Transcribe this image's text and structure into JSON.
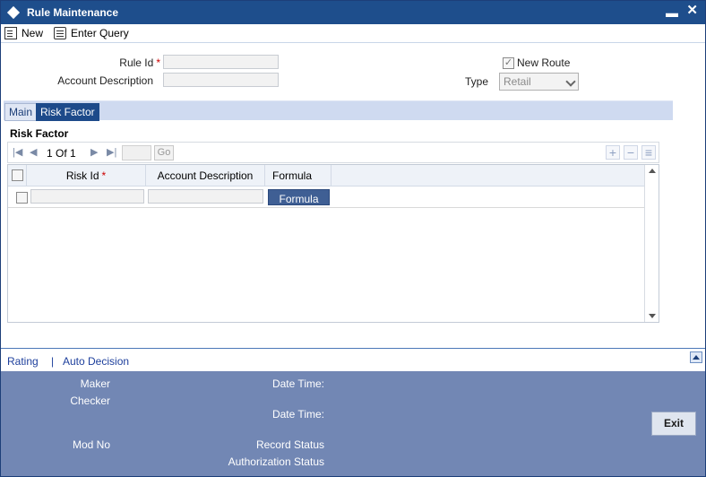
{
  "window": {
    "title": "Rule Maintenance",
    "min_glyph": "▬",
    "close_glyph": "✕"
  },
  "toolbar": {
    "new_label": "New",
    "enter_query_label": "Enter Query"
  },
  "form": {
    "rule_id_label": "Rule Id",
    "required_mark": "*",
    "account_description_label": "Account Description",
    "new_route_label": "New Route",
    "new_route_checked": true,
    "type_label": "Type",
    "type_value": "Retail"
  },
  "tabs": [
    {
      "label": "Main",
      "active": false
    },
    {
      "label": "Risk Factor",
      "active": true
    }
  ],
  "risk_factor": {
    "section_title": "Risk Factor",
    "pager": {
      "current": "1",
      "of_label": "Of",
      "total": "1",
      "go_label": "Go"
    },
    "columns": [
      "Risk Id",
      "Account Description",
      "Formula"
    ],
    "row_button_label": "Formula"
  },
  "links": {
    "rating": "Rating",
    "separator": "|",
    "auto_decision": "Auto Decision"
  },
  "footer": {
    "maker_label": "Maker",
    "checker_label": "Checker",
    "date_time_label": "Date Time:",
    "mod_no_label": "Mod No",
    "record_status_label": "Record Status",
    "authorization_status_label": "Authorization Status",
    "exit_label": "Exit"
  },
  "colors": {
    "titlebar": "#1e4e8c",
    "footer": "#7287b4",
    "active_tab": "#1d4a8a",
    "link": "#1d3f9c"
  }
}
